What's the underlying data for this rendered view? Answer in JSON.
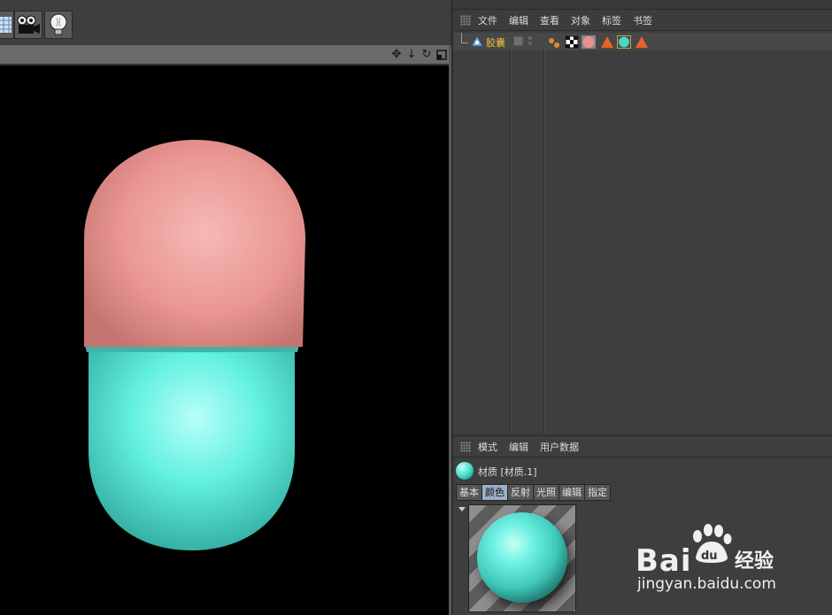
{
  "object_manager": {
    "menu": [
      "文件",
      "编辑",
      "查看",
      "对象",
      "标签",
      "书签"
    ],
    "object": {
      "name": "胶囊"
    }
  },
  "attribute_manager": {
    "menu": [
      "模式",
      "编辑",
      "用户数据"
    ],
    "title": "材质 [材质.1]",
    "tabs": [
      "基本",
      "颜色",
      "反射",
      "光照",
      "编辑",
      "指定"
    ],
    "active_tab": "颜色"
  },
  "viewport": {
    "capsule_top_color": "#e89894",
    "capsule_bottom_color": "#58ecd8"
  },
  "watermark": {
    "main": "Bai",
    "paw": "du",
    "cn": "经验",
    "url": "jingyan.baidu.com"
  },
  "icons": [
    "grid-icon",
    "camera-icon",
    "light-bulb-icon",
    "move-icon",
    "arrow-down-icon",
    "rotate-icon",
    "maximize-icon"
  ]
}
